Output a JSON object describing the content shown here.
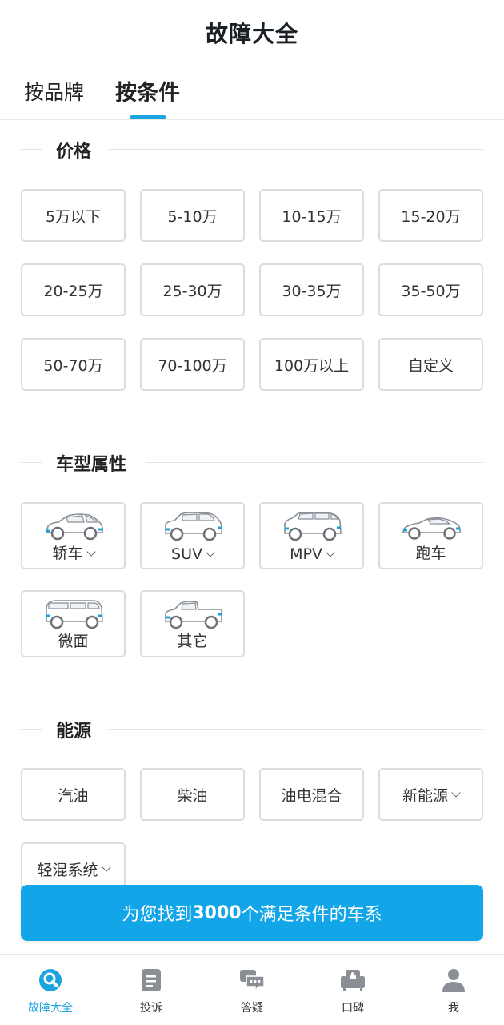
{
  "header": {
    "title": "故障大全"
  },
  "tabs": [
    {
      "label": "按品牌",
      "active": false
    },
    {
      "label": "按条件",
      "active": true
    }
  ],
  "price": {
    "title": "价格",
    "options": [
      "5万以下",
      "5-10万",
      "10-15万",
      "15-20万",
      "20-25万",
      "25-30万",
      "30-35万",
      "35-50万",
      "50-70万",
      "70-100万",
      "100万以上",
      "自定义"
    ]
  },
  "car_type": {
    "title": "车型属性",
    "options": [
      {
        "label": "轿车",
        "icon": "sedan-icon",
        "dropdown": true
      },
      {
        "label": "SUV",
        "icon": "suv-icon",
        "dropdown": true
      },
      {
        "label": "MPV",
        "icon": "mpv-icon",
        "dropdown": true
      },
      {
        "label": "跑车",
        "icon": "sports-car-icon",
        "dropdown": false
      },
      {
        "label": "微面",
        "icon": "minivan-icon",
        "dropdown": false
      },
      {
        "label": "其它",
        "icon": "pickup-icon",
        "dropdown": false
      }
    ]
  },
  "energy": {
    "title": "能源",
    "options": [
      {
        "label": "汽油",
        "dropdown": false
      },
      {
        "label": "柴油",
        "dropdown": false
      },
      {
        "label": "油电混合",
        "dropdown": false
      },
      {
        "label": "新能源",
        "dropdown": true
      },
      {
        "label": "轻混系统",
        "dropdown": true
      }
    ]
  },
  "cta": {
    "prefix": "为您找到",
    "count": "3000",
    "suffix": "个满足条件的车系"
  },
  "tabbar": [
    {
      "label": "故障大全",
      "icon": "fault-wrench-icon",
      "active": true
    },
    {
      "label": "投诉",
      "icon": "document-icon",
      "active": false
    },
    {
      "label": "答疑",
      "icon": "chat-icon",
      "active": false
    },
    {
      "label": "口碑",
      "icon": "sofa-icon",
      "active": false
    },
    {
      "label": "我",
      "icon": "user-icon",
      "active": false
    }
  ],
  "colors": {
    "accent": "#1ba3e0",
    "cta": "#12a5e8",
    "chip_border": "#dcdcdc",
    "icon_grey": "#8a8f96"
  }
}
